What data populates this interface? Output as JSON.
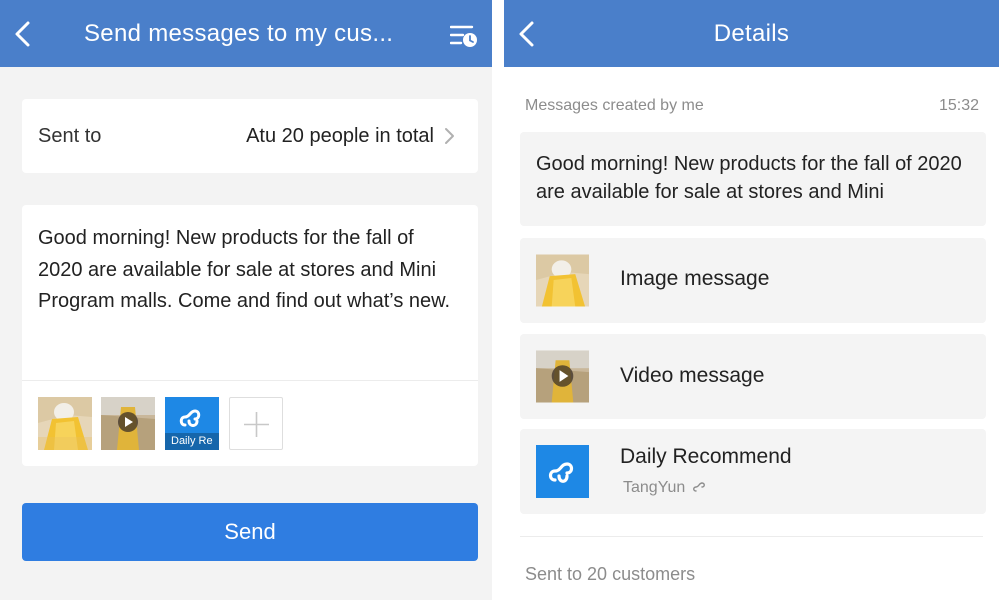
{
  "compose": {
    "header": {
      "title": "Send messages to my cus...",
      "back_icon": "chevron-left-icon",
      "history_icon": "schedule-list-icon"
    },
    "recipients": {
      "label": "Sent to",
      "value": "Atu 20 people in total"
    },
    "message": "Good morning! New products for the fall of 2020 are available for sale at stores and Mini Program malls. Come and find out what’s new.",
    "attachments": [
      {
        "type": "image",
        "icon": "image-thumbnail"
      },
      {
        "type": "video",
        "icon": "video-thumbnail"
      },
      {
        "type": "mini-program",
        "caption": "Daily Re",
        "icon": "mini-program-icon"
      }
    ],
    "add_icon": "plus-icon",
    "send_label": "Send",
    "colors": {
      "header": "#4a7fca",
      "send_button": "#2f7de1",
      "mini_program": "#1e88e5"
    }
  },
  "details": {
    "header": {
      "title": "Details",
      "back_icon": "chevron-left-icon"
    },
    "meta": {
      "label": "Messages created by me",
      "time": "15:32"
    },
    "message": "Good morning! New products for the fall of 2020 are available for sale at stores and Mini",
    "items": [
      {
        "type": "image",
        "label": "Image message"
      },
      {
        "type": "video",
        "label": "Video message"
      },
      {
        "type": "mini-program",
        "label": "Daily Recommend",
        "sub": "TangYun"
      }
    ],
    "footer": "Sent to 20 customers"
  }
}
